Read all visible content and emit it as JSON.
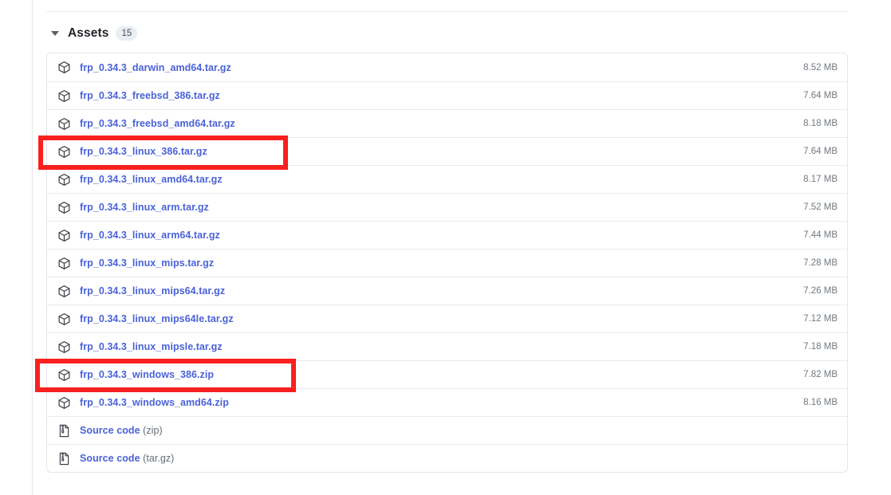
{
  "assets": {
    "section_label": "Assets",
    "count": "15",
    "caret_icon": "chevron-down-icon",
    "rows": [
      {
        "icon": "package-icon",
        "name": "frp_0.34.3_darwin_amd64.tar.gz",
        "size": "8.52 MB"
      },
      {
        "icon": "package-icon",
        "name": "frp_0.34.3_freebsd_386.tar.gz",
        "size": "7.64 MB"
      },
      {
        "icon": "package-icon",
        "name": "frp_0.34.3_freebsd_amd64.tar.gz",
        "size": "8.18 MB"
      },
      {
        "icon": "package-icon",
        "name": "frp_0.34.3_linux_386.tar.gz",
        "size": "7.64 MB"
      },
      {
        "icon": "package-icon",
        "name": "frp_0.34.3_linux_amd64.tar.gz",
        "size": "8.17 MB"
      },
      {
        "icon": "package-icon",
        "name": "frp_0.34.3_linux_arm.tar.gz",
        "size": "7.52 MB"
      },
      {
        "icon": "package-icon",
        "name": "frp_0.34.3_linux_arm64.tar.gz",
        "size": "7.44 MB"
      },
      {
        "icon": "package-icon",
        "name": "frp_0.34.3_linux_mips.tar.gz",
        "size": "7.28 MB"
      },
      {
        "icon": "package-icon",
        "name": "frp_0.34.3_linux_mips64.tar.gz",
        "size": "7.26 MB"
      },
      {
        "icon": "package-icon",
        "name": "frp_0.34.3_linux_mips64le.tar.gz",
        "size": "7.12 MB"
      },
      {
        "icon": "package-icon",
        "name": "frp_0.34.3_linux_mipsle.tar.gz",
        "size": "7.18 MB"
      },
      {
        "icon": "package-icon",
        "name": "frp_0.34.3_windows_386.zip",
        "size": "7.82 MB"
      },
      {
        "icon": "package-icon",
        "name": "frp_0.34.3_windows_amd64.zip",
        "size": "8.16 MB"
      },
      {
        "icon": "file-zip-icon",
        "name": "Source code",
        "suffix": " (zip)",
        "size": ""
      },
      {
        "icon": "file-zip-icon",
        "name": "Source code",
        "suffix": " (tar.gz)",
        "size": ""
      }
    ]
  },
  "annotations": [
    {
      "name": "annotation-linux-386",
      "target": "frp_0.34.3_linux_386.tar.gz",
      "color": "#fa2020"
    },
    {
      "name": "annotation-windows-386",
      "target": "frp_0.34.3_windows_386.zip",
      "color": "#fa2020"
    }
  ]
}
